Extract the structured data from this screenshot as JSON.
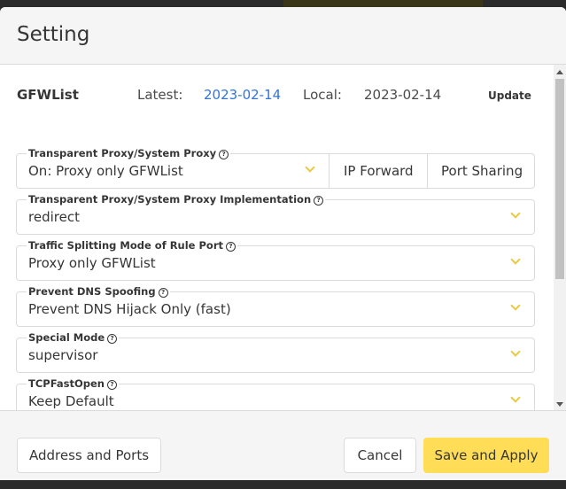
{
  "dialog": {
    "title": "Setting"
  },
  "gfwlist": {
    "label": "GFWList",
    "latest_label": "Latest:",
    "latest_value": "2023-02-14",
    "local_label": "Local:",
    "local_value": "2023-02-14",
    "update_label": "Update"
  },
  "fields": [
    {
      "label": "Transparent Proxy/System Proxy",
      "value": "On: Proxy only GFWList",
      "addons": [
        "IP Forward",
        "Port Sharing"
      ]
    },
    {
      "label": "Transparent Proxy/System Proxy Implementation",
      "value": "redirect"
    },
    {
      "label": "Traffic Splitting Mode of Rule Port",
      "value": "Proxy only GFWList"
    },
    {
      "label": "Prevent DNS Spoofing",
      "value": "Prevent DNS Hijack Only (fast)"
    },
    {
      "label": "Special Mode",
      "value": "supervisor"
    },
    {
      "label": "TCPFastOpen",
      "value": "Keep Default"
    }
  ],
  "footer": {
    "address_ports_label": "Address and Ports",
    "cancel_label": "Cancel",
    "save_apply_label": "Save and Apply"
  },
  "colors": {
    "accent": "#ffdd57",
    "link": "#3273dc",
    "chevron": "#e8c940"
  }
}
